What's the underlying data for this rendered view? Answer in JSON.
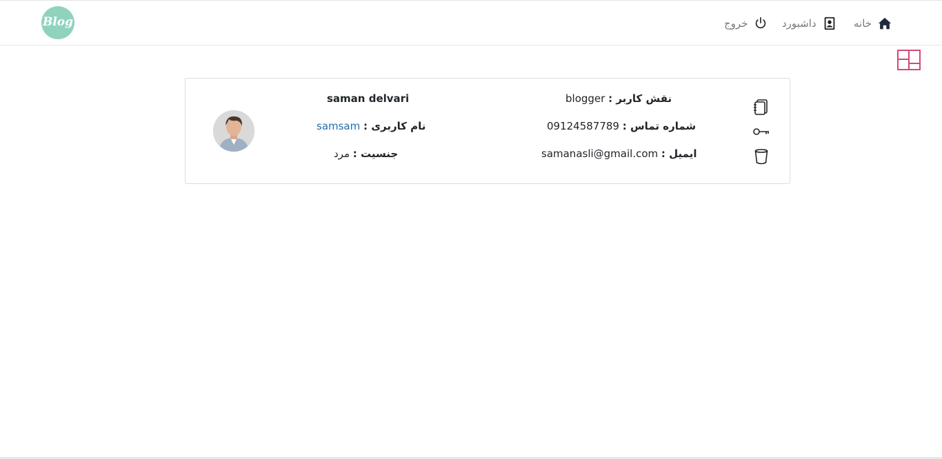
{
  "navbar": {
    "logo_text": "Blog",
    "home_label": "خانه",
    "dashboard_label": "داشبورد",
    "logout_label": "خروج"
  },
  "profile": {
    "full_name": "saman delvari",
    "username_label": "نام کاربری :",
    "username_value": "samsam",
    "gender_label": "جنسیت :",
    "gender_value": "مرد",
    "role_label": "نقش کاربر :",
    "role_value": "blogger",
    "phone_label": "شماره تماس :",
    "phone_value": "09124587789",
    "email_label": "ایمیل :",
    "email_value": "samanasli@gmail.com"
  },
  "colors": {
    "logo": "#8fd3bf",
    "accent_pink": "#d4487a",
    "link_blue": "#1f6fb2"
  },
  "icons": {
    "home": "home-icon",
    "dashboard": "contact-badge-icon",
    "logout": "power-icon",
    "layout": "layout-grid-icon",
    "posts": "notebook-icon",
    "password": "key-icon",
    "delete": "trash-icon"
  }
}
